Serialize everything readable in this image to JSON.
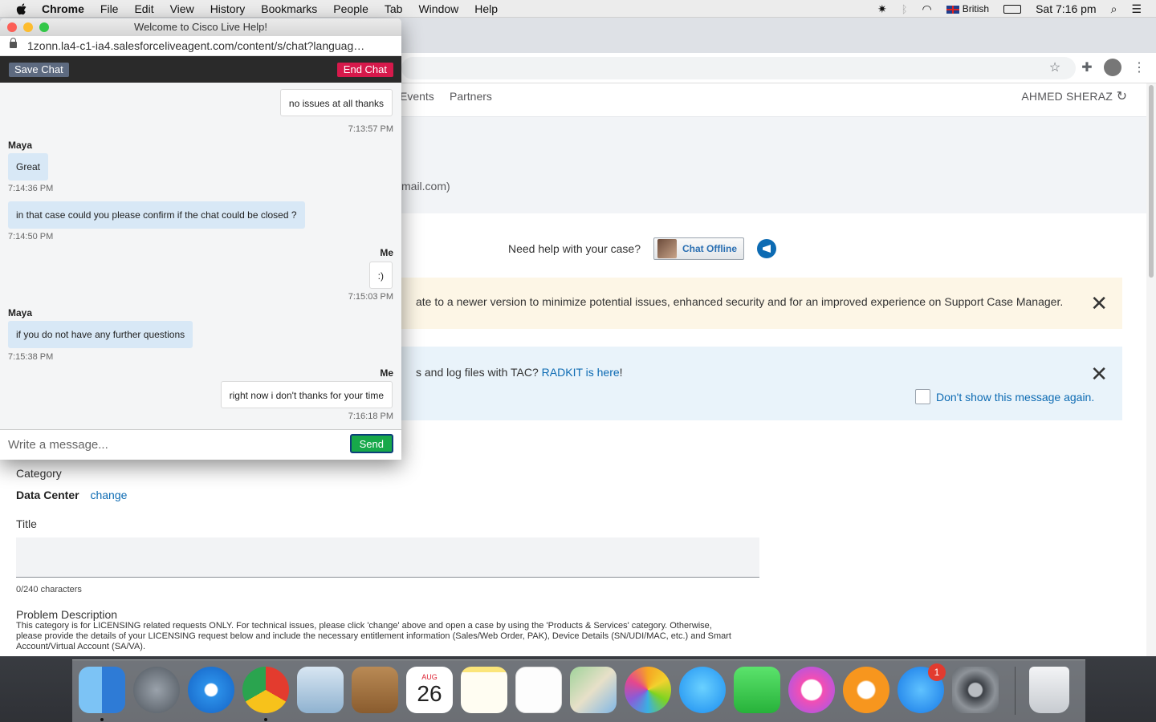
{
  "menubar": {
    "app": "Chrome",
    "items": [
      "File",
      "Edit",
      "View",
      "History",
      "Bookmarks",
      "People",
      "Tab",
      "Window",
      "Help"
    ],
    "input_source": "British",
    "clock": "Sat 7:16 pm"
  },
  "site": {
    "nav_items": [
      "Events",
      "Partners"
    ],
    "user_name": "AHMED SHERAZ",
    "email_fragment": "mail.com)",
    "help_question": "Need help with your case?",
    "chat_button": "Chat Offline",
    "warning_text": "ate to a newer version to minimize potential issues, enhanced security and for an improved experience on Support Case Manager.",
    "info_text_before": "s and log files with TAC?",
    "info_link": "RADKIT is here",
    "info_text_after": "!",
    "dont_show": "Don't show this message again.",
    "form": {
      "category_label": "Category",
      "category_value": "Data Center",
      "change_link": "change",
      "title_label": "Title",
      "char_count": "0/240 characters",
      "problem_label": "Problem Description",
      "problem_text": "This category is for LICENSING related requests ONLY. For technical issues, please click 'change' above and open a case by using the 'Products & Services' category. Otherwise, please provide the details of your LICENSING request below and include the necessary entitlement information (Sales/Web Order, PAK), Device Details (SN/UDI/MAC, etc.) and Smart Account/Virtual Account (SA/VA)."
    }
  },
  "chat": {
    "window_title": "Welcome to Cisco Live Help!",
    "url": "1zonn.la4-c1-ia4.salesforceliveagent.com/content/s/chat?languag…",
    "save_label": "Save Chat",
    "end_label": "End Chat",
    "messages": [
      {
        "sender": "",
        "text": "no issues at all thanks",
        "time": "7:13:57 PM"
      },
      {
        "sender": "Maya",
        "text": "Great",
        "time": "7:14:36 PM"
      },
      {
        "sender": "",
        "text": "in that case could you please confirm if the chat could be closed ?",
        "time": "7:14:50 PM"
      },
      {
        "sender": "Me",
        "text": ":)",
        "time": "7:15:03 PM"
      },
      {
        "sender": "Maya",
        "text": "if you do not have any further questions",
        "time": "7:15:38 PM"
      },
      {
        "sender": "Me",
        "text": "right now i don't thanks for your time",
        "time": "7:16:18 PM"
      }
    ],
    "input_placeholder": "Write a message...",
    "send_label": "Send"
  },
  "dock": {
    "calendar_month": "AUG",
    "calendar_day": "26",
    "appstore_badge": "1",
    "apps": [
      "finder-icon",
      "launchpad-icon",
      "safari-icon",
      "chrome-icon",
      "mail-icon",
      "contacts-icon",
      "calendar-icon",
      "notes-icon",
      "reminders-icon",
      "maps-icon",
      "photos-icon",
      "messages-icon",
      "facetime-icon",
      "itunes-icon",
      "ibooks-icon",
      "app-store-icon",
      "system-preferences-icon",
      "trash-icon"
    ]
  }
}
